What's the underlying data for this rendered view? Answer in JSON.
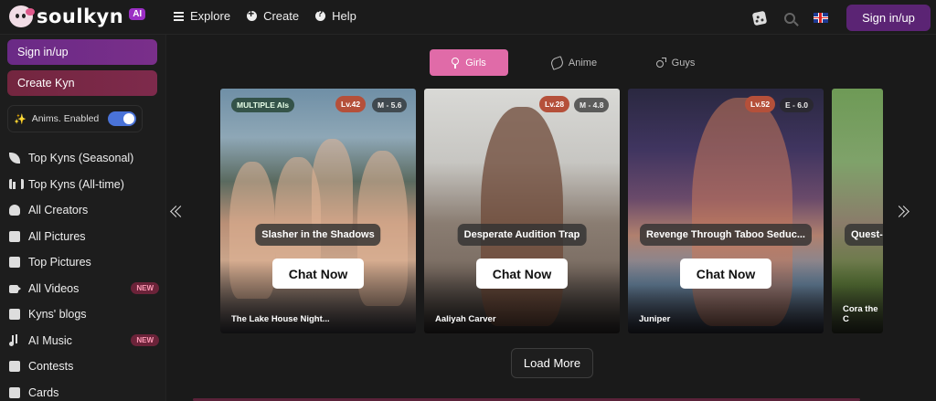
{
  "brand": {
    "name": "soulkyn",
    "badge": "AI"
  },
  "topnav": [
    {
      "label": "Explore",
      "icon": "menu-icon"
    },
    {
      "label": "Create",
      "icon": "plus-circle-icon"
    },
    {
      "label": "Help",
      "icon": "help-icon"
    }
  ],
  "header": {
    "signin_label": "Sign in/up"
  },
  "sidebar": {
    "signin_label": "Sign in/up",
    "create_label": "Create Kyn",
    "anims_label": "Anims. Enabled",
    "anims_enabled": true,
    "items": [
      {
        "label": "Top Kyns (Seasonal)",
        "icon": "leaf-icon"
      },
      {
        "label": "Top Kyns (All-time)",
        "icon": "bar-chart-icon"
      },
      {
        "label": "All Creators",
        "icon": "users-icon"
      },
      {
        "label": "All Pictures",
        "icon": "image-icon"
      },
      {
        "label": "Top Pictures",
        "icon": "image-icon"
      },
      {
        "label": "All Videos",
        "icon": "video-icon",
        "badge": "NEW"
      },
      {
        "label": "Kyns' blogs",
        "icon": "book-icon"
      },
      {
        "label": "AI Music",
        "icon": "music-icon",
        "badge": "NEW"
      },
      {
        "label": "Contests",
        "icon": "trophy-icon"
      },
      {
        "label": "Cards",
        "icon": "cards-icon"
      }
    ]
  },
  "tabs": [
    {
      "label": "Girls",
      "icon": "female-icon",
      "active": true
    },
    {
      "label": "Anime",
      "icon": "anime-icon",
      "active": false
    },
    {
      "label": "Guys",
      "icon": "male-icon",
      "active": false
    }
  ],
  "cards": [
    {
      "badge": "MULTIPLE AIs",
      "level": "Lv.42",
      "rating": "M - 5.6",
      "title": "Slasher in the Shadows",
      "cta": "Chat Now",
      "name": "The Lake House Night..."
    },
    {
      "badge": "",
      "level": "Lv.28",
      "rating": "M - 4.8",
      "title": "Desperate Audition Trap",
      "cta": "Chat Now",
      "name": "Aaliyah Carver"
    },
    {
      "badge": "",
      "level": "Lv.52",
      "rating": "E - 6.0",
      "title": "Revenge Through Taboo Seduc...",
      "cta": "Chat Now",
      "name": "Juniper"
    },
    {
      "badge": "",
      "level": "",
      "rating": "",
      "title": "Quest-",
      "cta": "",
      "name": "Cora the C"
    }
  ],
  "load_more_label": "Load More"
}
